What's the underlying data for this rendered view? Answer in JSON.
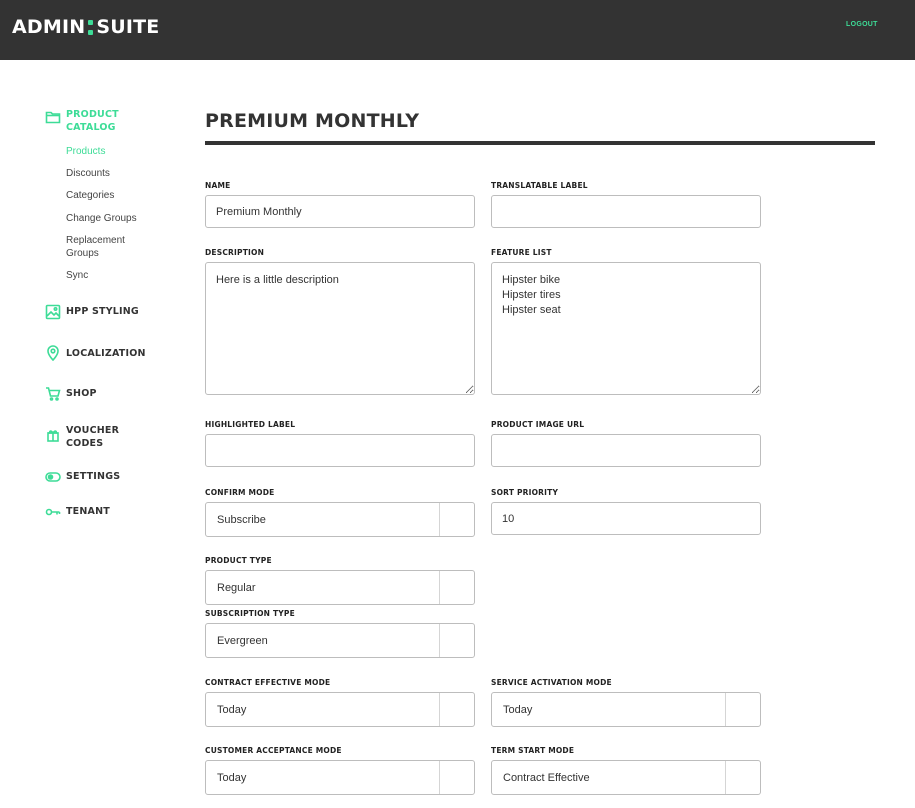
{
  "header": {
    "logo_left": "ADMIN",
    "logo_right": "SUITE",
    "logout_label": "LOGOUT",
    "accent_color": "#3ddc97",
    "bar_color": "#333333"
  },
  "sidebar": {
    "sections": [
      {
        "label": "PRODUCT CATALOG",
        "icon": "folder-icon",
        "active": true
      },
      {
        "label": "HPP STYLING",
        "icon": "image-icon"
      },
      {
        "label": "LOCALIZATION",
        "icon": "map-pin-icon"
      },
      {
        "label": "SHOP",
        "icon": "cart-icon"
      },
      {
        "label": "VOUCHER CODES",
        "icon": "gift-icon"
      },
      {
        "label": "SETTINGS",
        "icon": "toggle-icon"
      },
      {
        "label": "TENANT",
        "icon": "key-icon"
      }
    ],
    "catalog_items": [
      "Products",
      "Discounts",
      "Categories",
      "Change Groups",
      "Replacement Groups",
      "Sync"
    ]
  },
  "page": {
    "title": "PREMIUM MONTHLY"
  },
  "form": {
    "name": {
      "label": "NAME",
      "value": "Premium Monthly"
    },
    "translatable_label": {
      "label": "TRANSLATABLE LABEL",
      "value": ""
    },
    "description": {
      "label": "DESCRIPTION",
      "value": "Here is a little description"
    },
    "feature_list": {
      "label": "FEATURE LIST",
      "value": "Hipster bike\nHipster tires\nHipster seat"
    },
    "highlighted_label": {
      "label": "HIGHLIGHTED LABEL",
      "value": ""
    },
    "product_image_url": {
      "label": "PRODUCT IMAGE URL",
      "value": ""
    },
    "confirm_mode": {
      "label": "CONFIRM MODE",
      "value": "Subscribe"
    },
    "sort_priority": {
      "label": "SORT PRIORITY",
      "value": "10"
    },
    "product_type": {
      "label": "PRODUCT TYPE",
      "value": "Regular"
    },
    "subscription_type": {
      "label": "SUBSCRIPTION TYPE",
      "value": "Evergreen"
    },
    "contract_effective_mode": {
      "label": "CONTRACT EFFECTIVE MODE",
      "value": "Today"
    },
    "service_activation_mode": {
      "label": "SERVICE ACTIVATION MODE",
      "value": "Today"
    },
    "customer_acceptance_mode": {
      "label": "CUSTOMER ACCEPTANCE MODE",
      "value": "Today"
    },
    "term_start_mode": {
      "label": "TERM START MODE",
      "value": "Contract Effective"
    }
  }
}
